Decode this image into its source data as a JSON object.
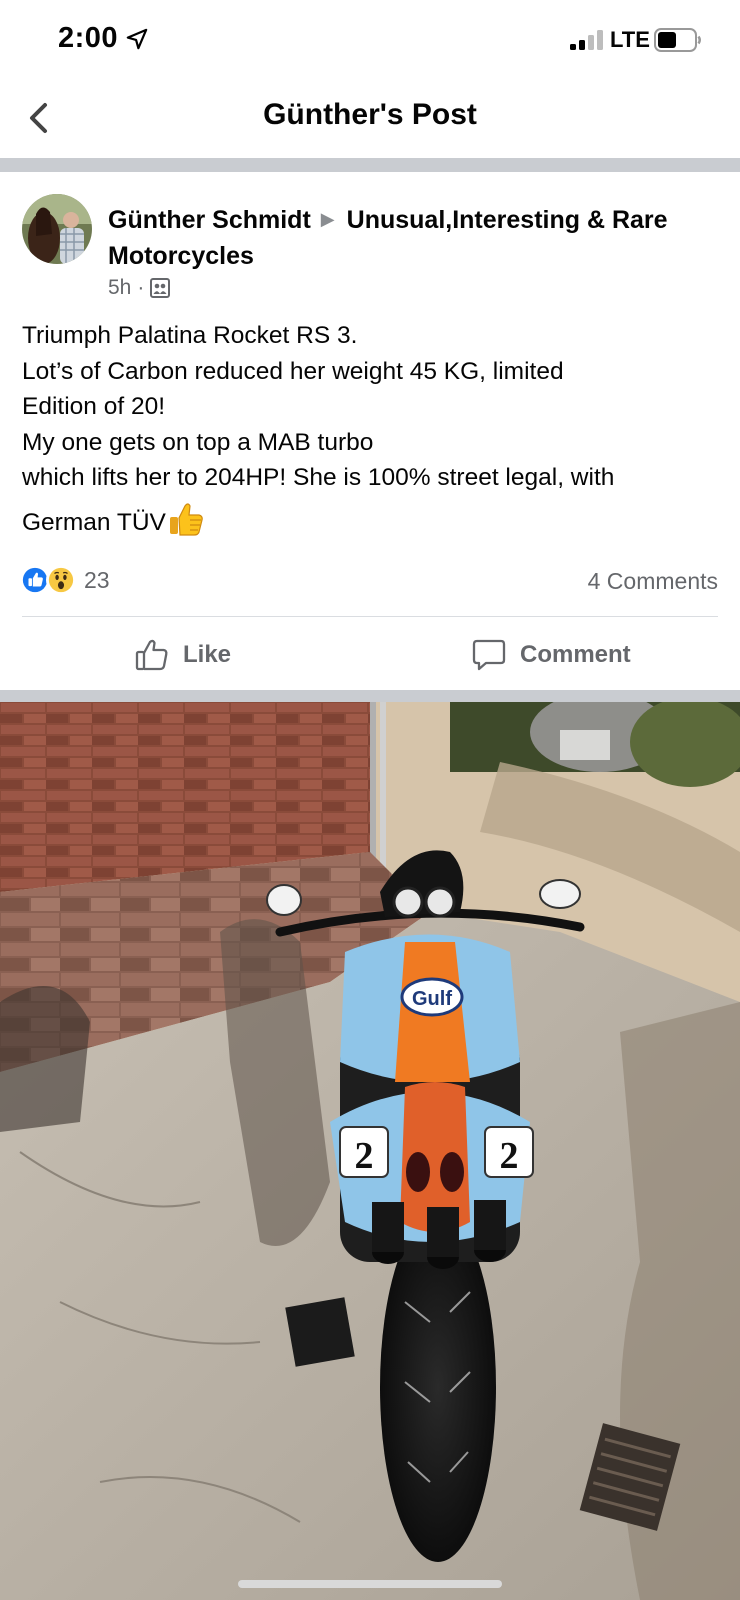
{
  "status_bar": {
    "time": "2:00",
    "network": "LTE"
  },
  "nav": {
    "title": "Günther's Post"
  },
  "post": {
    "author": "Günther Schmidt",
    "group": "Unusual,Interesting & Rare Motorcycles",
    "time": "5h",
    "lines": [
      "Triumph Palatina Rocket RS 3.",
      "Lot’s of Carbon reduced her weight 45 KG, limited",
      "Edition of 20!",
      "My one gets on top a MAB turbo",
      "which lifts her to 204HP! She is 100% street legal, with",
      "German TÜV"
    ],
    "reaction_count": "23",
    "comments_count": "4 Comments",
    "photo_texts": {
      "brand": "Gulf",
      "race_number": "2"
    }
  },
  "actions": {
    "like_label": "Like",
    "comment_label": "Comment"
  },
  "icons": {
    "back": "chevron-left-icon",
    "location": "location-arrow-icon",
    "audience": "group-audience-icon",
    "like_reaction": "like-reaction-icon",
    "wow_reaction": "wow-reaction-icon",
    "thumbs_up_emoji": "thumbs-up-emoji-icon"
  },
  "colors": {
    "facebook_blue": "#1877f2",
    "divider": "#c9ccd1",
    "secondary_text": "#65676b",
    "gulf_blue": "#8fc5e8",
    "gulf_orange": "#f07a22"
  }
}
